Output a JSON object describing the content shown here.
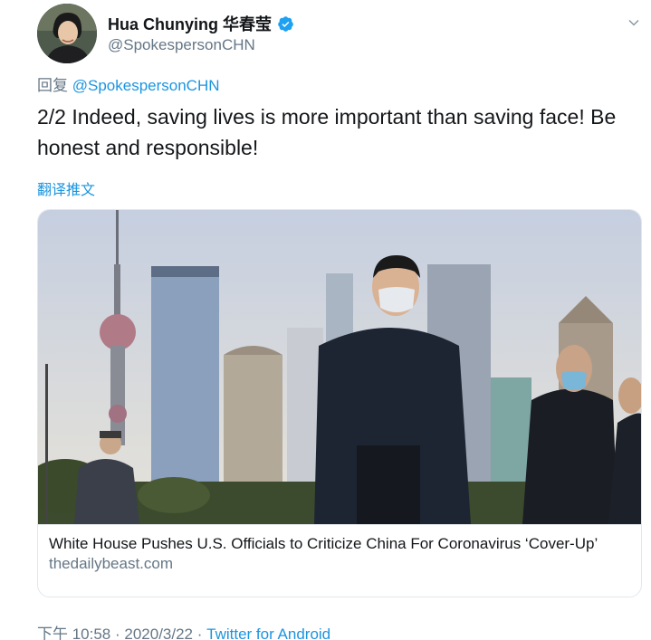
{
  "author": {
    "display_name": "Hua Chunying 华春莹",
    "handle": "@SpokespersonCHN"
  },
  "reply": {
    "prefix": "回复",
    "mention": "@SpokespersonCHN"
  },
  "tweet": {
    "text": "2/2 Indeed, saving lives is more important than saving face! Be honest and responsible!",
    "translate_label": "翻译推文"
  },
  "card": {
    "title": "White House Pushes U.S. Officials to Criticize China For Coronavirus ‘Cover-Up’",
    "domain": "thedailybeast.com"
  },
  "meta": {
    "time": "下午 10:58",
    "separator1": " · ",
    "date": "2020/3/22",
    "separator2": " · ",
    "source": "Twitter for Android"
  },
  "colors": {
    "link": "#1b95e0",
    "secondary_text": "#657786",
    "verified": "#1da1f2"
  }
}
